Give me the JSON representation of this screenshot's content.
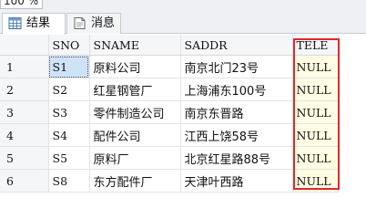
{
  "zoom": {
    "value": "100 %"
  },
  "tabs": [
    {
      "label": "结果",
      "icon": "results-grid-icon"
    },
    {
      "label": "消息",
      "icon": "messages-icon"
    }
  ],
  "grid": {
    "columns": [
      "",
      "SNO",
      "SNAME",
      "SADDR",
      "TELE"
    ],
    "rows": [
      {
        "num": "1",
        "sno": "S1",
        "sname": "原料公司",
        "saddr": "南京北门23号",
        "tele": "NULL"
      },
      {
        "num": "2",
        "sno": "S2",
        "sname": "红星钢管厂",
        "saddr": "上海浦东100号",
        "tele": "NULL"
      },
      {
        "num": "3",
        "sno": "S3",
        "sname": "零件制造公司",
        "saddr": "南京东晋路",
        "tele": "NULL"
      },
      {
        "num": "4",
        "sno": "S4",
        "sname": "配件公司",
        "saddr": "江西上饶58号",
        "tele": "NULL"
      },
      {
        "num": "5",
        "sno": "S5",
        "sname": "原料厂",
        "saddr": "北京红星路88号",
        "tele": "NULL"
      },
      {
        "num": "6",
        "sno": "S8",
        "sname": "东方配件厂",
        "saddr": "天津叶西路",
        "tele": "NULL"
      }
    ]
  },
  "colors": {
    "highlight": "#e0292c",
    "selected_cell": "#cfe3f8",
    "null_cell": "#fffde3"
  }
}
